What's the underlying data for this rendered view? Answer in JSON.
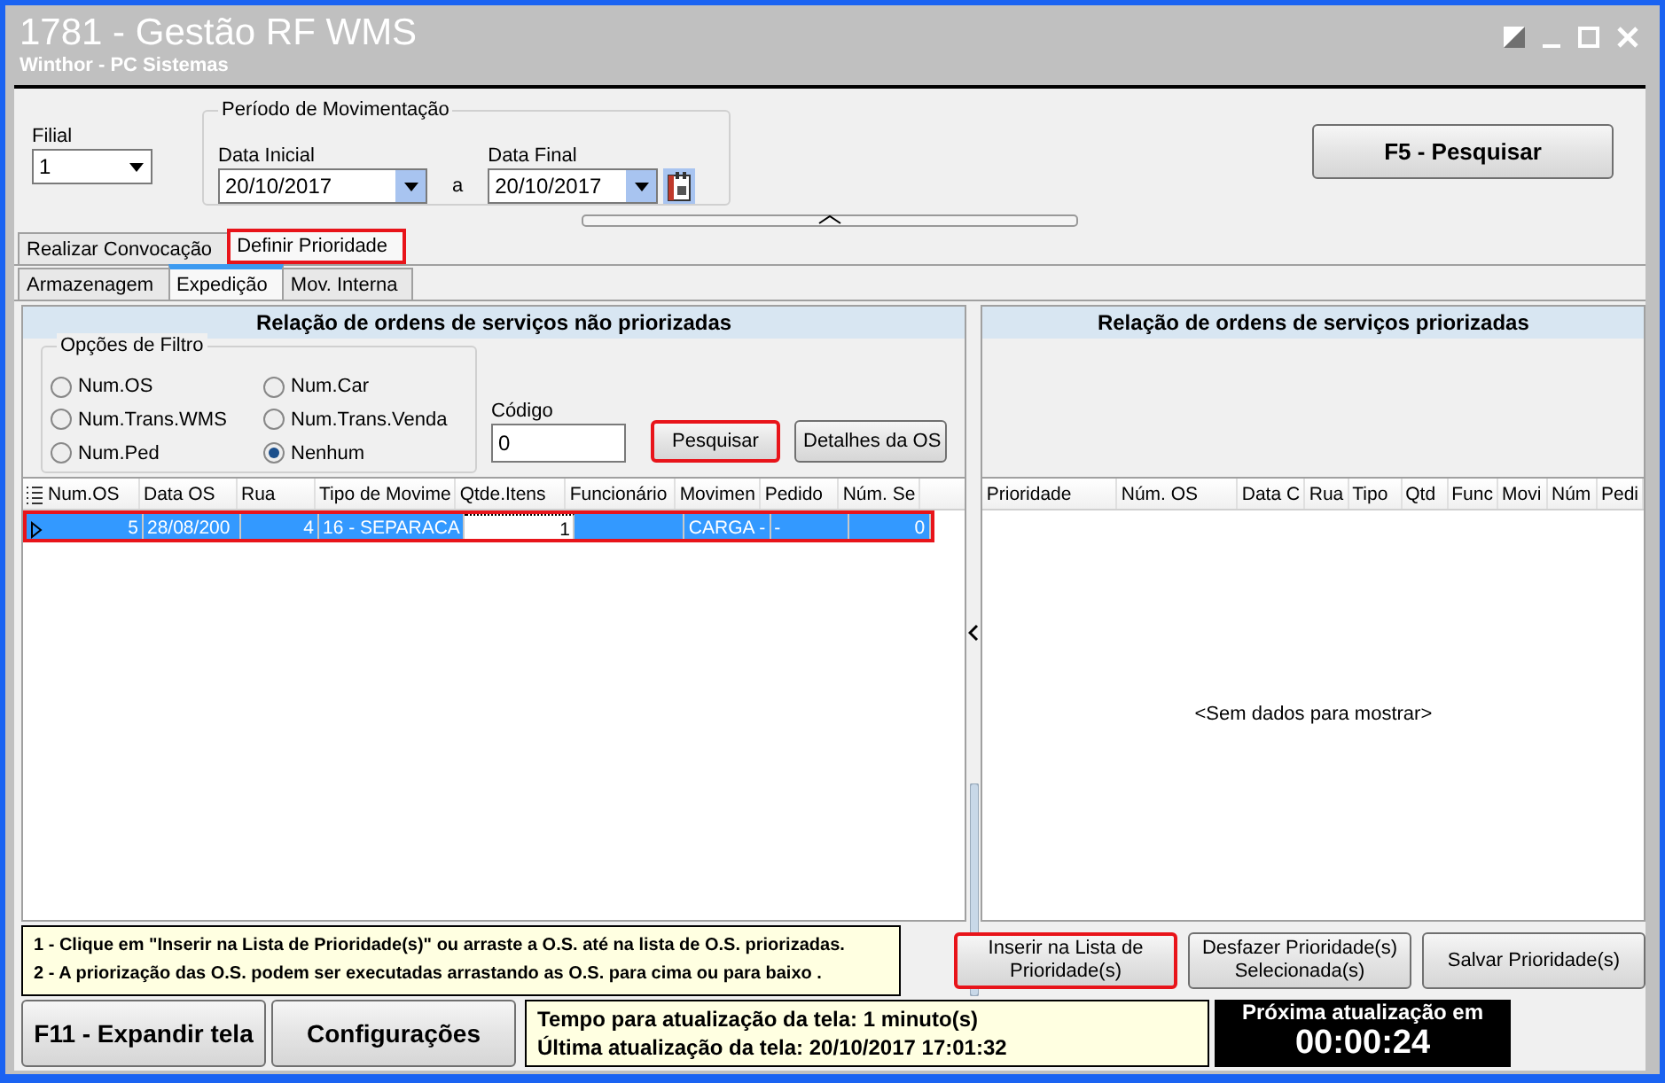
{
  "window": {
    "title": "1781 - Gestão RF WMS",
    "subtitle": "Winthor - PC Sistemas"
  },
  "filters_top": {
    "filial": {
      "label": "Filial",
      "value": "1"
    },
    "period": {
      "legend": "Período de Movimentação",
      "start_label": "Data Inicial",
      "start_value": "20/10/2017",
      "separator": "a",
      "end_label": "Data Final",
      "end_value": "20/10/2017"
    },
    "search_button": "F5 - Pesquisar"
  },
  "tabs": [
    {
      "label": "Realizar Convocação",
      "selected": false,
      "highlighted": false
    },
    {
      "label": "Definir Prioridade",
      "selected": true,
      "highlighted": true
    }
  ],
  "subtabs": [
    {
      "label": "Armazenagem",
      "selected": false
    },
    {
      "label": "Expedição",
      "selected": true
    },
    {
      "label": "Mov. Interna",
      "selected": false
    }
  ],
  "left_panel": {
    "title": "Relação de ordens de serviços não priorizadas",
    "filter_legend": "Opções de Filtro",
    "filter_options": [
      {
        "label": "Num.OS",
        "selected": false
      },
      {
        "label": "Num.Car",
        "selected": false
      },
      {
        "label": "Num.Trans.WMS",
        "selected": false
      },
      {
        "label": "Num.Trans.Venda",
        "selected": false
      },
      {
        "label": "Num.Ped",
        "selected": false
      },
      {
        "label": "Nenhum",
        "selected": true
      }
    ],
    "code_label": "Código",
    "code_value": "0",
    "buttons": [
      {
        "label": "Pesquisar",
        "highlighted": true
      },
      {
        "label": "Detalhes da OS",
        "highlighted": false
      }
    ],
    "columns": [
      {
        "label": "Num.OS",
        "kind": "number"
      },
      {
        "label": "Data OS",
        "kind": "text"
      },
      {
        "label": "Rua",
        "kind": "number"
      },
      {
        "label": "Tipo de Movime",
        "kind": "text"
      },
      {
        "label": "Qtde.Itens",
        "kind": "number"
      },
      {
        "label": "Funcionário",
        "kind": "text"
      },
      {
        "label": "Movimen",
        "kind": "text"
      },
      {
        "label": "Pedido",
        "kind": "text"
      },
      {
        "label": "Núm. Se",
        "kind": "number"
      }
    ],
    "rows": [
      {
        "selected": true,
        "highlighted": true,
        "cells": [
          {
            "text": "5",
            "editing": false
          },
          {
            "text": "28/08/200",
            "editing": false
          },
          {
            "text": "4",
            "editing": false
          },
          {
            "text": "16 - SEPARACA",
            "editing": false
          },
          {
            "text": "1",
            "editing": true
          },
          {
            "text": "",
            "editing": false
          },
          {
            "text": "CARGA -",
            "editing": false
          },
          {
            "text": "-",
            "editing": false
          },
          {
            "text": "0",
            "editing": false
          }
        ]
      }
    ]
  },
  "right_panel": {
    "title": "Relação de ordens de serviços priorizadas",
    "columns": [
      "Prioridade",
      "Núm. OS",
      "Data C",
      "Rua",
      "Tipo",
      "Qtd",
      "Func",
      "Movi",
      "Núm",
      "Pedi"
    ],
    "empty_text": "<Sem dados para mostrar>"
  },
  "instructions": [
    "1 - Clique em \"Inserir na Lista de Prioridade(s)\" ou arraste a O.S. até na lista  de O.S. priorizadas.",
    "2 - A priorização das O.S. podem ser executadas arrastando as O.S. para cima ou para baixo ."
  ],
  "priority_buttons": [
    {
      "label": "Inserir na Lista de Prioridade(s)",
      "highlighted": true
    },
    {
      "label": "Desfazer Prioridade(s) Selecionada(s)",
      "highlighted": false
    },
    {
      "label": "Salvar Prioridade(s)",
      "highlighted": false
    }
  ],
  "footer": {
    "buttons": [
      "F11 - Expandir tela",
      "Configurações"
    ],
    "status_lines": [
      "Tempo para atualização da tela: 1 minuto(s)",
      "Última atualização da tela: 20/10/2017 17:01:32"
    ],
    "countdown_label": "Próxima atualização em",
    "countdown": "00:00:24"
  }
}
